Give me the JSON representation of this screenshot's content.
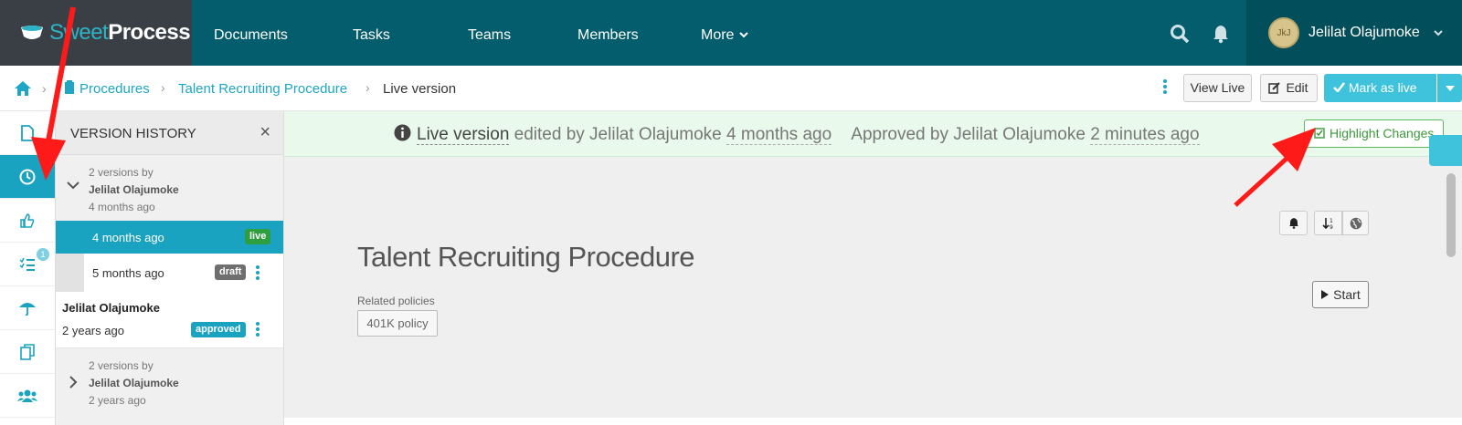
{
  "brand": {
    "sweet": "Sweet",
    "process": "Process"
  },
  "nav": {
    "items": [
      "Documents",
      "Tasks",
      "Teams",
      "Members",
      "More"
    ],
    "user_name": "Jelilat Olajumoke",
    "avatar_text": "JkJ"
  },
  "breadcrumb": {
    "procedures": "Procedures",
    "procedure_name": "Talent Recruiting Procedure",
    "current": "Live version"
  },
  "toolbar": {
    "view_live": "View Live",
    "edit": "Edit",
    "mark_live": "Mark as live"
  },
  "sidebar": {
    "badge_count": "1"
  },
  "version_history": {
    "title": "VERSION HISTORY",
    "group1": {
      "count_line": "2 versions by",
      "author": "Jelilat Olajumoke",
      "when": "4 months ago"
    },
    "live_version": {
      "when": "4 months ago",
      "badge": "live"
    },
    "draft_version": {
      "when": "5 months ago",
      "badge": "draft"
    },
    "approved_version": {
      "author": "Jelilat Olajumoke",
      "when": "2 years ago",
      "badge": "approved"
    },
    "group2": {
      "count_line": "2 versions by",
      "author": "Jelilat Olajumoke",
      "when": "2 years ago"
    }
  },
  "banner": {
    "live_label": "Live version",
    "edited_by": " edited by Jelilat Olajumoke ",
    "edited_when": "4 months ago",
    "approved_by": "Approved by Jelilat Olajumoke ",
    "approved_when": "2 minutes ago",
    "highlight_btn": "Highlight Changes"
  },
  "procedure": {
    "title": "Talent Recruiting Procedure",
    "related_label": "Related policies",
    "policy": "401K policy",
    "start": "Start"
  },
  "colors": {
    "topbar": "#045d6c",
    "accent": "#1aa3c0",
    "live_badge": "#2e9e3e",
    "annotation": "#ff1a1a"
  }
}
